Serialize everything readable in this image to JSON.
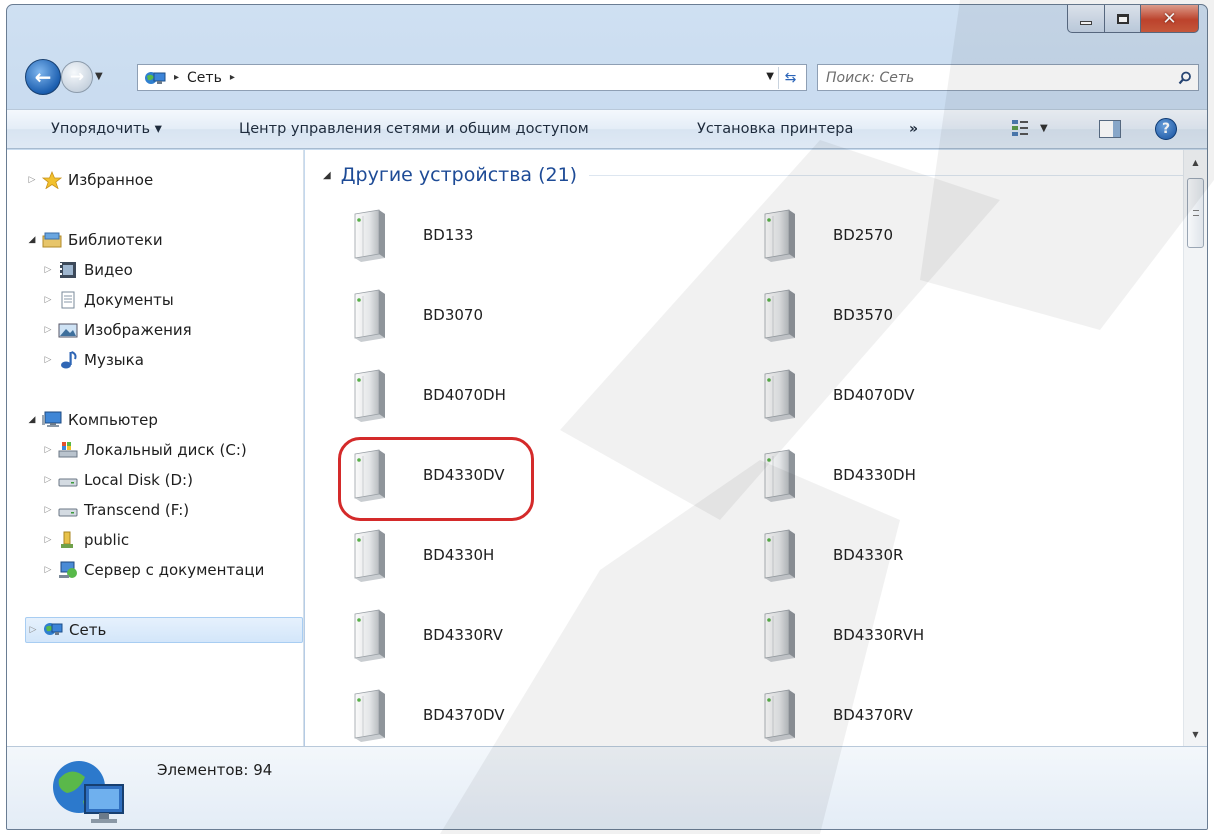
{
  "window": {
    "caption_min": "–",
    "caption_max": "□",
    "caption_close": "✕"
  },
  "address": {
    "path": "Сеть",
    "separator": "▸"
  },
  "search": {
    "placeholder": "Поиск: Сеть"
  },
  "toolbar": {
    "organize": "Упорядочить ▾",
    "network_center": "Центр управления сетями и общим доступом",
    "add_printer": "Установка принтера",
    "more": "»"
  },
  "navpane": {
    "favorites": "Избранное",
    "libraries": "Библиотеки",
    "videos": "Видео",
    "documents": "Документы",
    "pictures": "Изображения",
    "music": "Музыка",
    "computer": "Компьютер",
    "local_c": "Локальный диск (C:)",
    "local_d": "Local Disk (D:)",
    "transcend": "Transcend (F:)",
    "public": "public",
    "docserver": "Сервер с документаци",
    "network": "Сеть"
  },
  "content": {
    "group_label": "Другие устройства (21)",
    "devices": [
      "BD133",
      "BD2570",
      "BD3070",
      "BD3570",
      "BD4070DH",
      "BD4070DV",
      "BD4330DV",
      "BD4330DH",
      "BD4330H",
      "BD4330R",
      "BD4330RV",
      "BD4330RVH",
      "BD4370DV",
      "BD4370RV"
    ],
    "highlighted_device": "BD4330DV"
  },
  "details": {
    "count_text": "Элементов: 94"
  },
  "colors": {
    "group_header": "#1e4b96",
    "highlight_circle": "#d42a2a",
    "close_button": "#c7472f",
    "selection": "#d3e6fa"
  },
  "icons": [
    "back-arrow-icon",
    "forward-arrow-icon",
    "network-icon",
    "refresh-icon",
    "search-icon",
    "views-icon",
    "preview-pane-icon",
    "help-icon",
    "star-icon",
    "library-icon",
    "video-icon",
    "document-icon",
    "picture-icon",
    "music-icon",
    "computer-icon",
    "drive-icon",
    "folder-icon",
    "server-icon",
    "media-device-icon",
    "globe-network-icon"
  ]
}
